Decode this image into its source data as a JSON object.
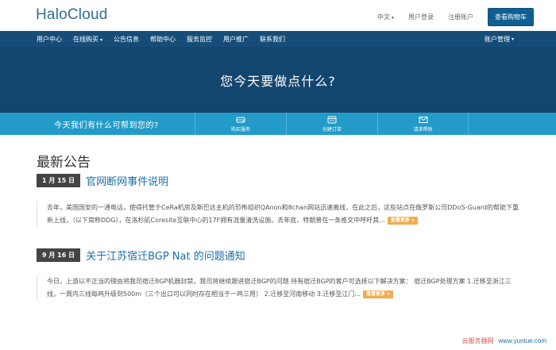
{
  "header": {
    "logo": "HaloCloud",
    "language": "中文",
    "language_caret": "▾",
    "login": "用户登录",
    "register": "注册账户",
    "cart_button": "查看购物车"
  },
  "nav": {
    "items": [
      {
        "label": "用户中心"
      },
      {
        "label": "在线购买",
        "caret": "▾"
      },
      {
        "label": "公告信息"
      },
      {
        "label": "帮助中心"
      },
      {
        "label": "服务监控"
      },
      {
        "label": "用户推广"
      },
      {
        "label": "联系我们"
      }
    ],
    "account": "账户管理",
    "account_caret": "▾"
  },
  "hero": {
    "title": "您今天要做点什么?"
  },
  "helpbar": {
    "text": "今天我们有什么可帮到您的?",
    "tiles": [
      {
        "label": "购买服务",
        "icon": "server-icon"
      },
      {
        "label": "创建订单",
        "icon": "order-icon"
      },
      {
        "label": "请求帮助",
        "icon": "envelope-icon"
      }
    ]
  },
  "announcements": {
    "section_title": "最新公告",
    "items": [
      {
        "date": "1 月 15 日",
        "title": "官网断网事件说明",
        "body": "去年，美国国安的一通电话，使得托管于CeRa机房及斯巴达主机的恐怖组织QAnon和8chan网站迅速离线，在此之后，这些站点在俄罗斯公司DDoS-Guard的帮助下重新上线，（以下简称DDG），在洛杉矶Coresite互联中心的17F拥有流量清洗设施。去年底，特朗普在一条推文中呼吁其...",
        "more": "查看更多 »"
      },
      {
        "date": "9 月 16 日",
        "title": "关于江苏宿迁BGP Nat 的问题通知",
        "body": "今日，上游以不正当的理由将我司宿迁BGP机器封禁，我司将继续跟进宿迁BGP的问题 持有宿迁BGP的客户可选择以下解决方案： 宿迁BGP处理方案 1.迁移至浙江三线，一周内三线每鸡升级到500m（三个出口可以同时存在相当于一鸡三用） 2.迁移至河南移动 3.迁移至江门...",
        "more": "查看更多 »"
      }
    ]
  },
  "watermark": {
    "cn": "云服务器网",
    "url": "www.yuntue.com"
  },
  "colors": {
    "nav_bg": "#164d78",
    "hero_bg": "#13466f",
    "helpbar_bg": "#229bc9",
    "link": "#1a6fa8",
    "more_button": "#f0ad4e"
  }
}
